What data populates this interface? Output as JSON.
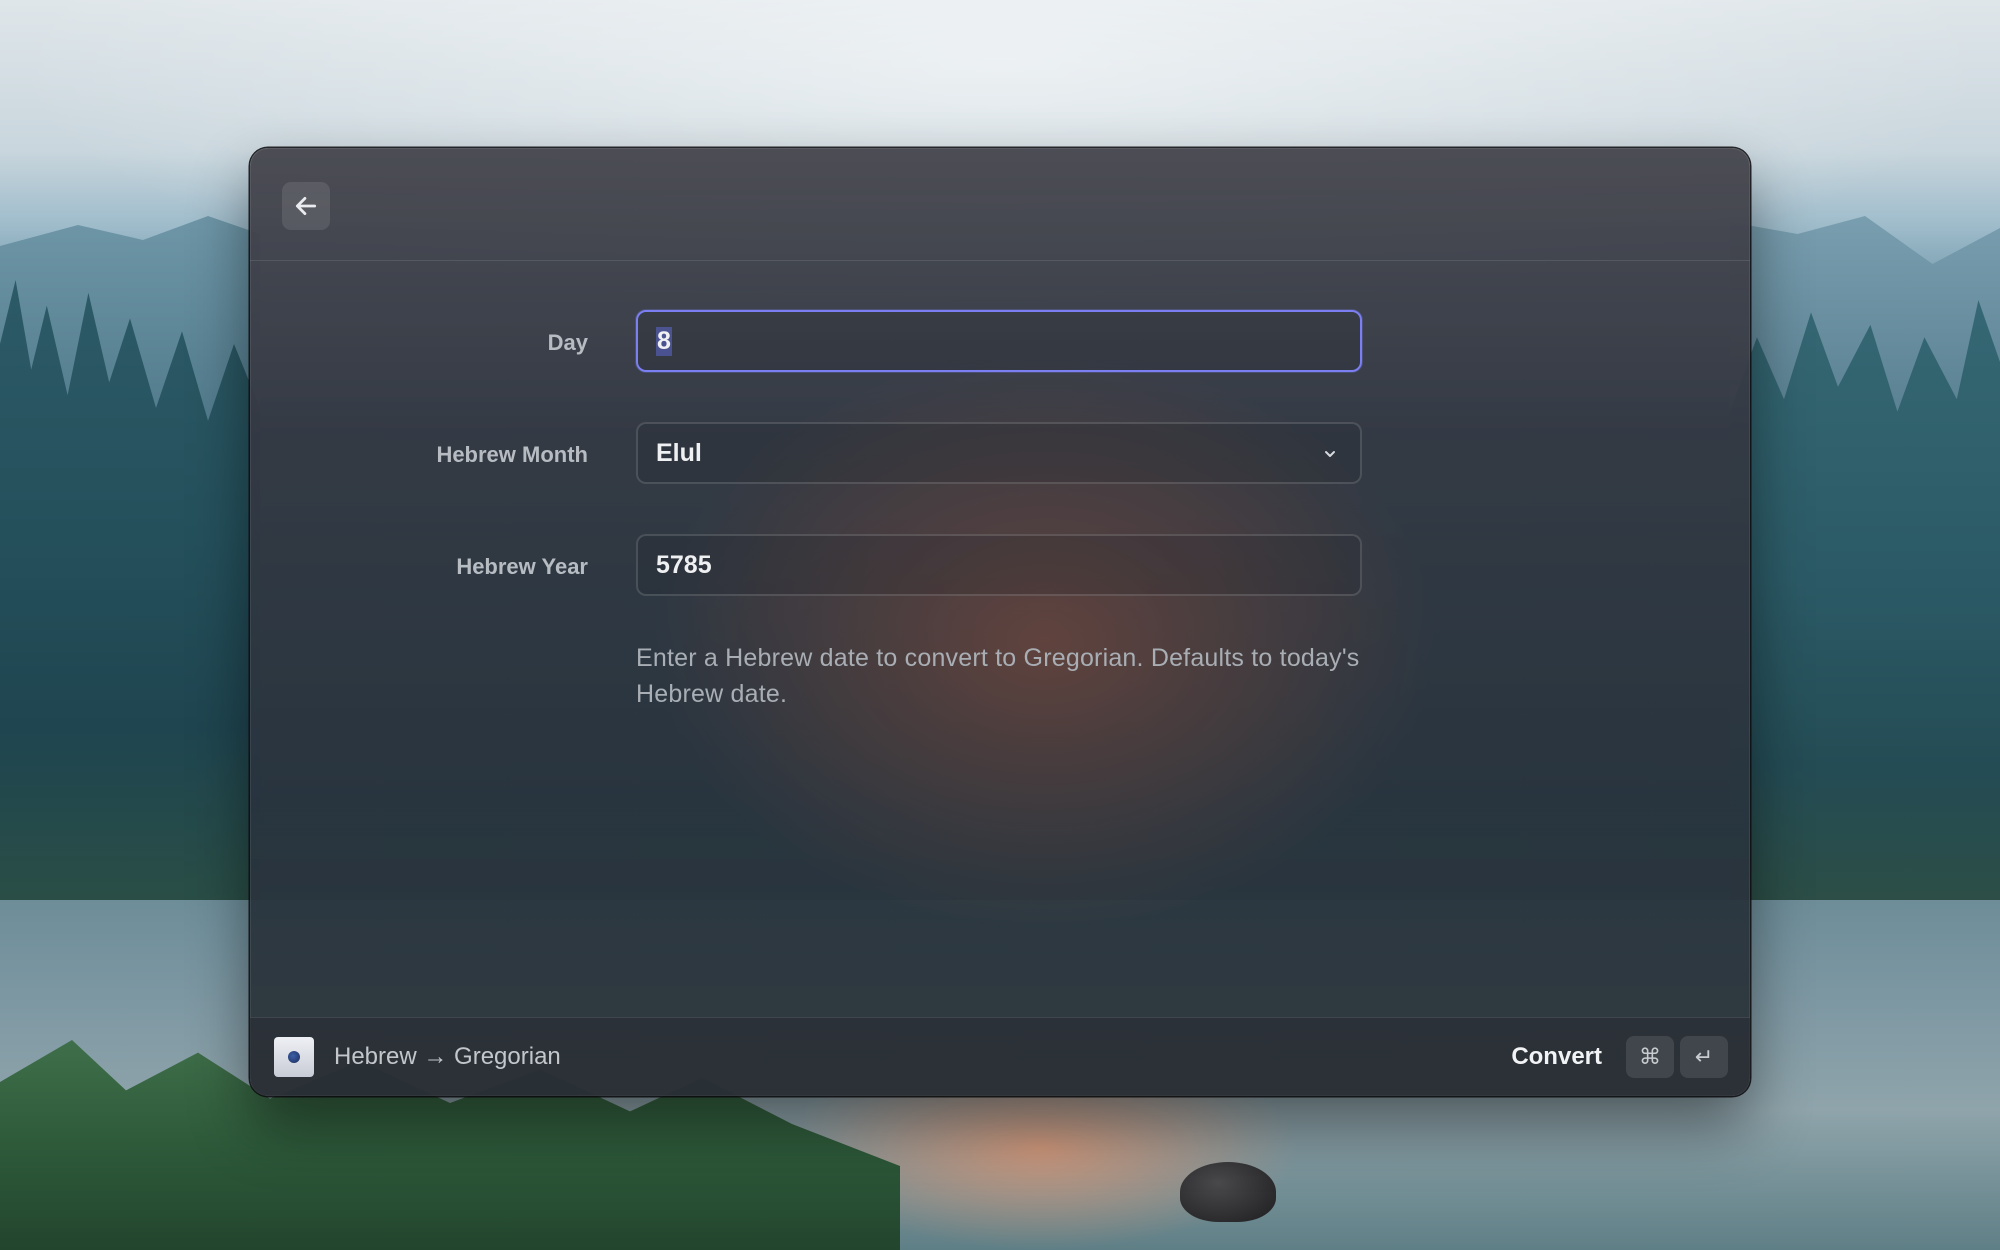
{
  "header": {
    "back_icon": "arrow-left-icon"
  },
  "form": {
    "day": {
      "label": "Day",
      "value": "8"
    },
    "month": {
      "label": "Hebrew Month",
      "value": "Elul",
      "icon": "chevron-down-icon"
    },
    "year": {
      "label": "Hebrew Year",
      "value": "5785"
    },
    "helper_text": "Enter a Hebrew date to convert to Gregorian. Defaults to today's Hebrew date."
  },
  "footer": {
    "app_icon": "app-icon",
    "title": "Hebrew → Gregorian",
    "action_label": "Convert",
    "shortcut_keys": [
      "⌘",
      "↵"
    ]
  },
  "colors": {
    "focus_border": "#7b7ff2",
    "label": "#b7bcc2",
    "field_text": "#eef0f2"
  }
}
